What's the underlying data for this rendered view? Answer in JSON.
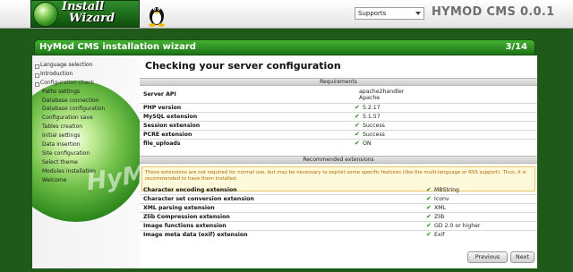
{
  "header": {
    "logo_line1": "Install",
    "logo_line2": "Wizard",
    "language_select": {
      "selected": "Supports"
    },
    "app_title": "HYMOD CMS 0.0.1"
  },
  "wizard": {
    "title": "HyMod CMS installation wizard",
    "step": "3/14"
  },
  "sidebar": {
    "brand_watermark": "HyMod CMS",
    "items": [
      {
        "label": "Language selection",
        "level": "top"
      },
      {
        "label": "Introduction",
        "level": "top"
      },
      {
        "label": "Configuration check",
        "level": "top",
        "state": "current"
      },
      {
        "label": "Paths settings",
        "level": "sub"
      },
      {
        "label": "Database connection",
        "level": "sub"
      },
      {
        "label": "Database configuration",
        "level": "sub"
      },
      {
        "label": "Configuration save",
        "level": "sub"
      },
      {
        "label": "Tables creation",
        "level": "sub"
      },
      {
        "label": "Initial settings",
        "level": "sub"
      },
      {
        "label": "Data insertion",
        "level": "sub"
      },
      {
        "label": "Site configuration",
        "level": "sub"
      },
      {
        "label": "Select theme",
        "level": "sub"
      },
      {
        "label": "Modules installation",
        "level": "sub"
      },
      {
        "label": "Welcome",
        "level": "sub"
      }
    ]
  },
  "main": {
    "page_title": "Checking your server configuration",
    "requirements": {
      "heading": "Requirements",
      "rows": [
        {
          "label": "Server API",
          "value_line1": "apache2handler",
          "value_line2": "Apache",
          "check": false
        },
        {
          "label": "PHP version",
          "value": "5.2.17",
          "check": true
        },
        {
          "label": "MySQL extension",
          "value": "5.1.57",
          "check": true
        },
        {
          "label": "Session extension",
          "value": "Success",
          "check": true
        },
        {
          "label": "PCRE extension",
          "value": "Success",
          "check": true
        },
        {
          "label": "file_uploads",
          "value": "ON",
          "check": true
        }
      ]
    },
    "recommended": {
      "heading": "Recommended extensions",
      "notice": "These extensions are not required for normal use, but may be necessary to exploit some specific features (like the multi-language or RSS support). Thus, it is recommended to have them installed.",
      "rows": [
        {
          "label": "Character encoding extension",
          "value": "MBString"
        },
        {
          "label": "Character set conversion extension",
          "value": "Iconv"
        },
        {
          "label": "XML parsing extension",
          "value": "XML"
        },
        {
          "label": "Zlib Compression extension",
          "value": "Zlib"
        },
        {
          "label": "Image functions extension",
          "value": "GD 2.0 or higher"
        },
        {
          "label": "Image meta data (exif) extension",
          "value": "Exif"
        }
      ]
    },
    "buttons": {
      "previous": "Previous",
      "next": "Next"
    },
    "check_glyph": "✔"
  }
}
